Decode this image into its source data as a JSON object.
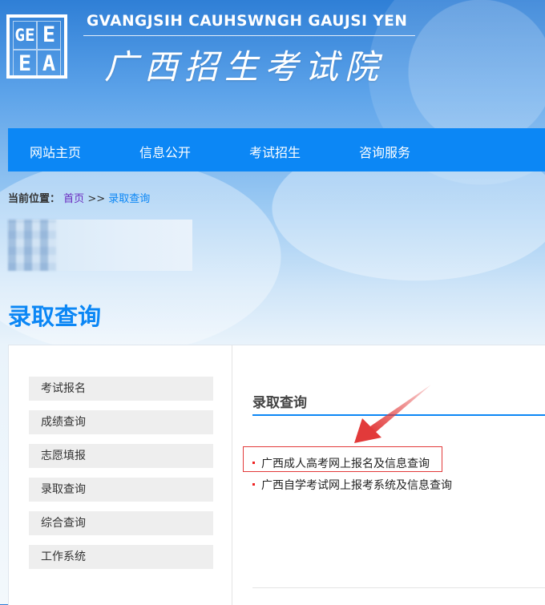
{
  "header": {
    "logo_letters": [
      "GE",
      "E",
      "E",
      "A"
    ],
    "site_name_en": "GVANGJSIH CAUHSWNGH GAUJSI YEN",
    "site_name_cn": "广西招生考试院"
  },
  "nav": {
    "items": [
      "网站主页",
      "信息公开",
      "考试招生",
      "咨询服务"
    ]
  },
  "breadcrumb": {
    "label": "当前位置：",
    "home": "首页",
    "separator": ">>",
    "current": "录取查询"
  },
  "page": {
    "title": "录取查询"
  },
  "sidebar": {
    "items": [
      "考试报名",
      "成绩查询",
      "志愿填报",
      "录取查询",
      "综合查询",
      "工作系统"
    ]
  },
  "main": {
    "heading": "录取查询",
    "links": [
      "广西成人高考网上报名及信息查询",
      "广西自学考试网上报考系统及信息查询"
    ]
  },
  "colors": {
    "accent": "#0c87f5",
    "highlight": "#e23a3a"
  }
}
